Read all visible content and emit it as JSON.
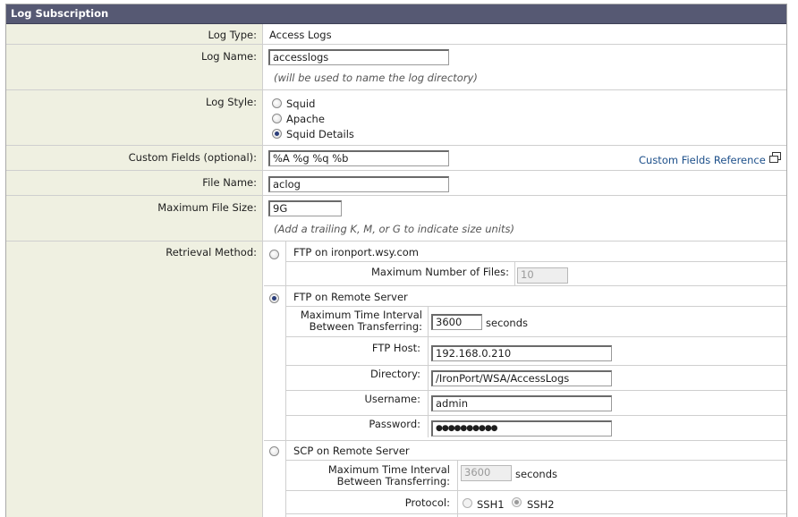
{
  "panel": {
    "title": "Log Subscription"
  },
  "log_type": {
    "label": "Log Type:",
    "value": "Access Logs"
  },
  "log_name": {
    "label": "Log Name:",
    "value": "accesslogs",
    "hint": "(will be used to name the log directory)"
  },
  "log_style": {
    "label": "Log Style:",
    "options": [
      "Squid",
      "Apache",
      "Squid Details"
    ],
    "selected": "Squid Details"
  },
  "custom_fields": {
    "label": "Custom Fields (optional):",
    "value": "%A %g %q %b",
    "reference_link": "Custom Fields Reference"
  },
  "file_name": {
    "label": "File Name:",
    "value": "aclog"
  },
  "max_file_size": {
    "label": "Maximum File Size:",
    "value": "9G",
    "hint": "(Add a trailing K, M, or G to indicate size units)"
  },
  "retrieval": {
    "label": "Retrieval Method:",
    "ftp_local": {
      "label": "FTP on ironport.wsy.com",
      "max_files_label": "Maximum Number of Files:",
      "max_files_value": "10"
    },
    "ftp_remote": {
      "label": "FTP on Remote Server",
      "interval_label_1": "Maximum Time Interval",
      "interval_label_2": "Between Transferring:",
      "interval_value": "3600",
      "interval_unit": "seconds",
      "host_label": "FTP Host:",
      "host_value": "192.168.0.210",
      "dir_label": "Directory:",
      "dir_value": "/IronPort/WSA/AccessLogs",
      "user_label": "Username:",
      "user_value": "admin",
      "pass_label": "Password:",
      "pass_value": "●●●●●●●●●●"
    },
    "scp_remote": {
      "label": "SCP on Remote Server",
      "interval_label_1": "Maximum Time Interval",
      "interval_label_2": "Between Transferring:",
      "interval_value": "3600",
      "interval_unit": "seconds",
      "protocol_label": "Protocol:",
      "protocol_options": [
        "SSH1",
        "SSH2"
      ],
      "protocol_selected": "SSH2"
    },
    "selected": "FTP on Remote Server"
  }
}
